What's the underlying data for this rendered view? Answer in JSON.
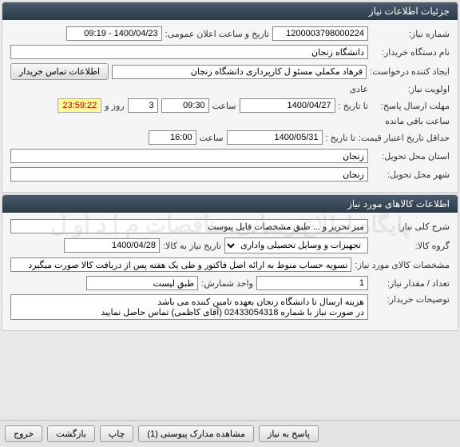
{
  "sections": {
    "need_info": "جزئیات اطلاعات نیاز",
    "items_info": "اطلاعات کالاهای مورد نیاز"
  },
  "fields": {
    "need_number_label": "شماره نیاز:",
    "need_number": "1200003798000224",
    "announce_datetime_label": "تاریخ و ساعت اعلان عمومی:",
    "announce_datetime": "1400/04/23 - 09:19",
    "buyer_org_label": "نام دستگاه خریدار:",
    "buyer_org": "دانشگاه زنجان",
    "requester_label": "ایجاد کننده درخواست:",
    "requester": "فرهاد مکملي مسئو ل کارپردازی دانشگاه زنجان",
    "buyer_contact_btn": "اطلاعات تماس خریدار",
    "priority_label": "اولویت نیاز:",
    "priority": "عادی",
    "deadline_label": "مهلت ارسال پاسخ:",
    "to_date_label": "تا تاریخ :",
    "deadline_date": "1400/04/27",
    "time_label": "ساعت",
    "deadline_time": "09:30",
    "remaining_days": "3",
    "days_and": "روز و",
    "remaining_time": "23:59:22",
    "remaining_label": "ساعت باقی مانده",
    "min_validity_label": "حداقل تاریخ اعتبار قیمت:",
    "validity_date": "1400/05/31",
    "validity_time": "16:00",
    "delivery_province_label": "استان محل تحویل:",
    "delivery_province": "زنجان",
    "delivery_city_label": "شهر محل تحویل:",
    "delivery_city": "زنجان",
    "desc_label": "شرح کلی نیاز:",
    "desc": "میز تحریر و ... طبق مشخصات فایل پیوست",
    "group_label": "گروه کالا:",
    "group": "تجهیزات و وسایل تحصیلی واداری",
    "item_date_label": "تاریخ نیاز به کالا:",
    "item_date": "1400/04/28",
    "item_spec_label": "مشخصات کالای مورد نیاز:",
    "item_spec": "تسویه حساب منوط به ارائه اصل فاکتور و طی یک هفته پس از دریافت کالا صورت میگیرد",
    "qty_label": "تعداد / مقدار نیاز:",
    "qty": "1",
    "unit_label": "واحد شمارش:",
    "unit": "طبق لیست",
    "buyer_notes_label": "توضیحات خریدار:",
    "buyer_notes": "هزینه ارسال تا دانشگاه زنجان بعهده تامین کننده می باشد\nدر صورت نیاز با شماره 02433054318 (آقای کاظمی) تماس حاصل نمایید"
  },
  "footer": {
    "respond": "پاسخ به نیاز",
    "view_attach": "مشاهده مدارک پیوستی (1)",
    "print": "چاپ",
    "back": "بازگشت",
    "exit": "خروج"
  },
  "watermark": "پایگاه اطلاع رسانی مناقصات م ا د او ل"
}
